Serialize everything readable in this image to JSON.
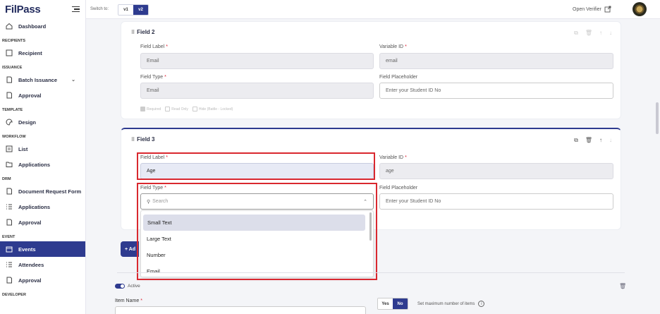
{
  "app": {
    "logo": "FilPass",
    "switch_label": "Switch to:",
    "versions": [
      "v1",
      "v2"
    ],
    "open_verifier": "Open Verifier"
  },
  "sidebar": {
    "dashboard": "Dashboard",
    "sections": {
      "recipients": "RECIPIENTS",
      "issuance": "ISSUANCE",
      "template": "TEMPLATE",
      "workflow": "WORKFLOW",
      "drm": "DRM",
      "event": "EVENT",
      "developer": "DEVELOPER"
    },
    "items": {
      "recipient": "Recipient",
      "batch_issuance": "Batch Issuance",
      "approval1": "Approval",
      "design": "Design",
      "list": "List",
      "applications1": "Applications",
      "document_request_form": "Document Request Form",
      "applications2": "Applications",
      "approval2": "Approval",
      "events": "Events",
      "attendees": "Attendees",
      "approval3": "Approval"
    }
  },
  "field2": {
    "title": "Field 2",
    "label_caption": "Field Label",
    "label_value": "Email",
    "varid_caption": "Variable ID",
    "varid_value": "email",
    "type_caption": "Field Type",
    "type_value": "Email",
    "placeholder_caption": "Field Placeholder",
    "placeholder_value": "Enter your Student ID No",
    "checks": [
      "Required",
      "Read Only",
      "Hide (Battle - Locked)"
    ]
  },
  "field3": {
    "title": "Field 3",
    "label_caption": "Field Label",
    "label_value": "Age",
    "varid_caption": "Variable ID",
    "varid_value": "age",
    "type_caption": "Field Type",
    "search_placeholder": "Search",
    "placeholder_caption": "Field Placeholder",
    "placeholder_value": "Enter your Student ID No"
  },
  "dropdown_options": [
    "Small Text",
    "Large Text",
    "Number",
    "Email"
  ],
  "add_button": "+ Ad",
  "bottom": {
    "active_label": "Active",
    "item_name_label": "Item Name",
    "yes": "Yes",
    "no": "No",
    "max_items_label": "Set maximum number of items"
  },
  "colors": {
    "accent": "#2e3b8f",
    "highlight_border": "#d9282f"
  }
}
